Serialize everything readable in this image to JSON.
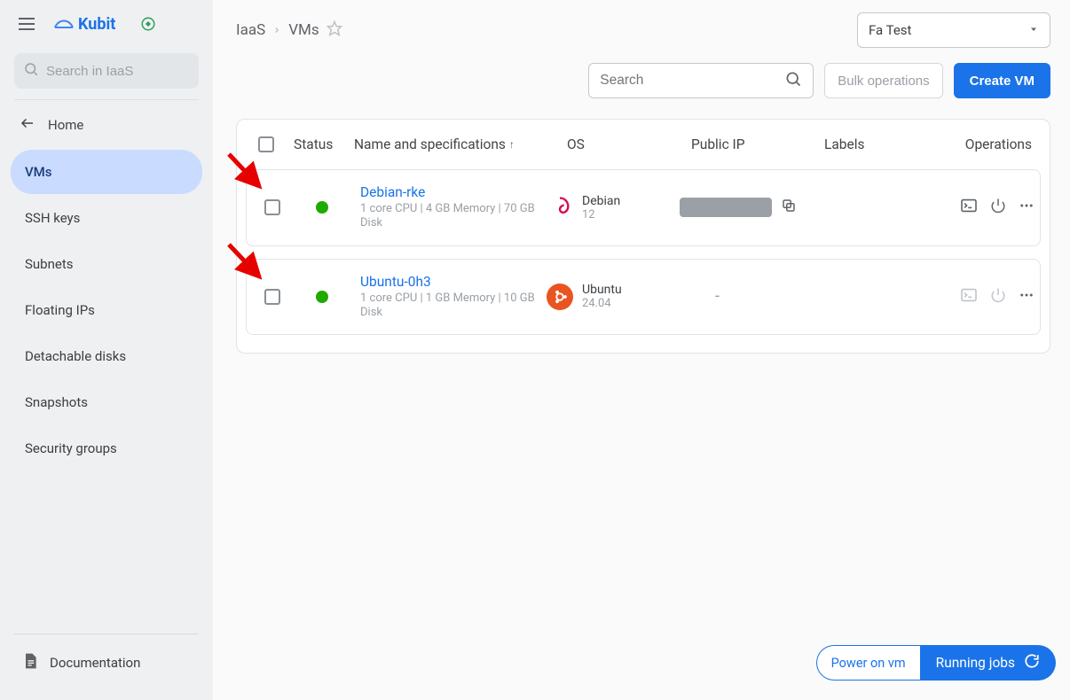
{
  "brand": "Kubit",
  "sidebar": {
    "search_placeholder": "Search in IaaS",
    "home_label": "Home",
    "items": [
      {
        "label": "VMs"
      },
      {
        "label": "SSH keys"
      },
      {
        "label": "Subnets"
      },
      {
        "label": "Floating IPs"
      },
      {
        "label": "Detachable disks"
      },
      {
        "label": "Snapshots"
      },
      {
        "label": "Security groups"
      }
    ],
    "docs_label": "Documentation"
  },
  "breadcrumb": {
    "a": "IaaS",
    "b": "VMs"
  },
  "project_selector": "Fa Test",
  "main_search_placeholder": "Search",
  "bulk_label": "Bulk operations",
  "create_label": "Create VM",
  "columns": {
    "status": "Status",
    "name": "Name and specifications",
    "os": "OS",
    "ip": "Public IP",
    "labels": "Labels",
    "ops": "Operations"
  },
  "rows": [
    {
      "name": "Debian-rke",
      "spec": "1 core CPU | 4 GB Memory | 70 GB Disk",
      "os_name": "Debian",
      "os_ver": "12",
      "has_ip": true,
      "status_color": "#1faa00"
    },
    {
      "name": "Ubuntu-0h3",
      "spec": "1 core CPU | 1 GB Memory | 10 GB Disk",
      "os_name": "Ubuntu",
      "os_ver": "24.04",
      "has_ip": false,
      "status_color": "#1faa00"
    }
  ],
  "float": {
    "left": "Power on vm",
    "right": "Running jobs"
  }
}
